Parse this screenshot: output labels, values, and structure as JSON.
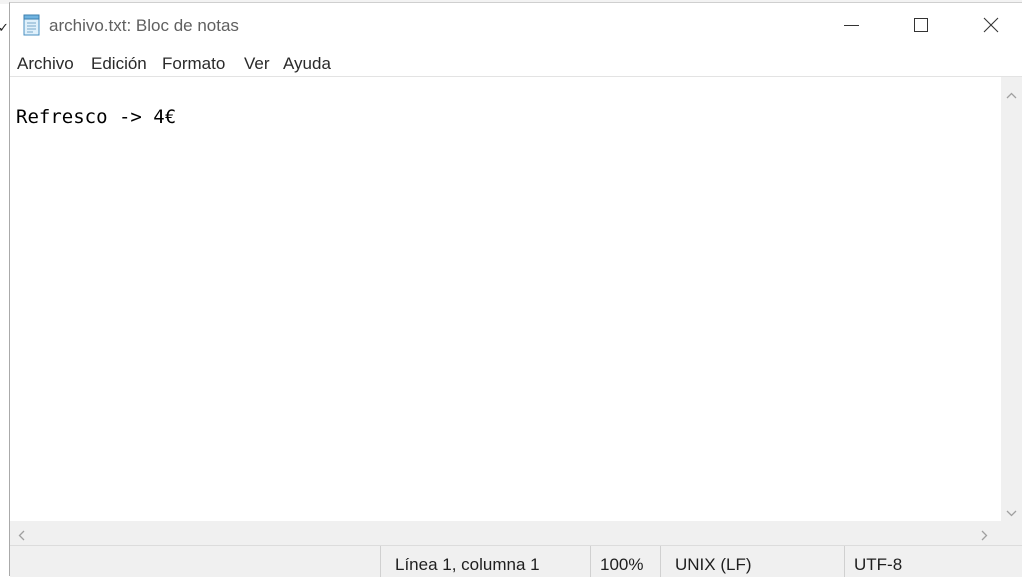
{
  "window": {
    "title": "archivo.txt: Bloc de notas",
    "icon": "notepad-icon",
    "controls": [
      "minimize-icon",
      "maximize-icon",
      "close-icon"
    ]
  },
  "menu": {
    "items": [
      "Archivo",
      "Edición",
      "Formato",
      "Ver",
      "Ayuda"
    ]
  },
  "editor": {
    "content": "Refresco -> 4€"
  },
  "statusbar": {
    "position": "Línea 1, columna 1",
    "zoom": "100%",
    "line_ending": "UNIX (LF)",
    "encoding": "UTF-8"
  },
  "colors": {
    "background": "#ffffff",
    "scrollbar": "#f0f0f0",
    "statusbar": "#f0f0f0",
    "title_text": "#606060"
  }
}
